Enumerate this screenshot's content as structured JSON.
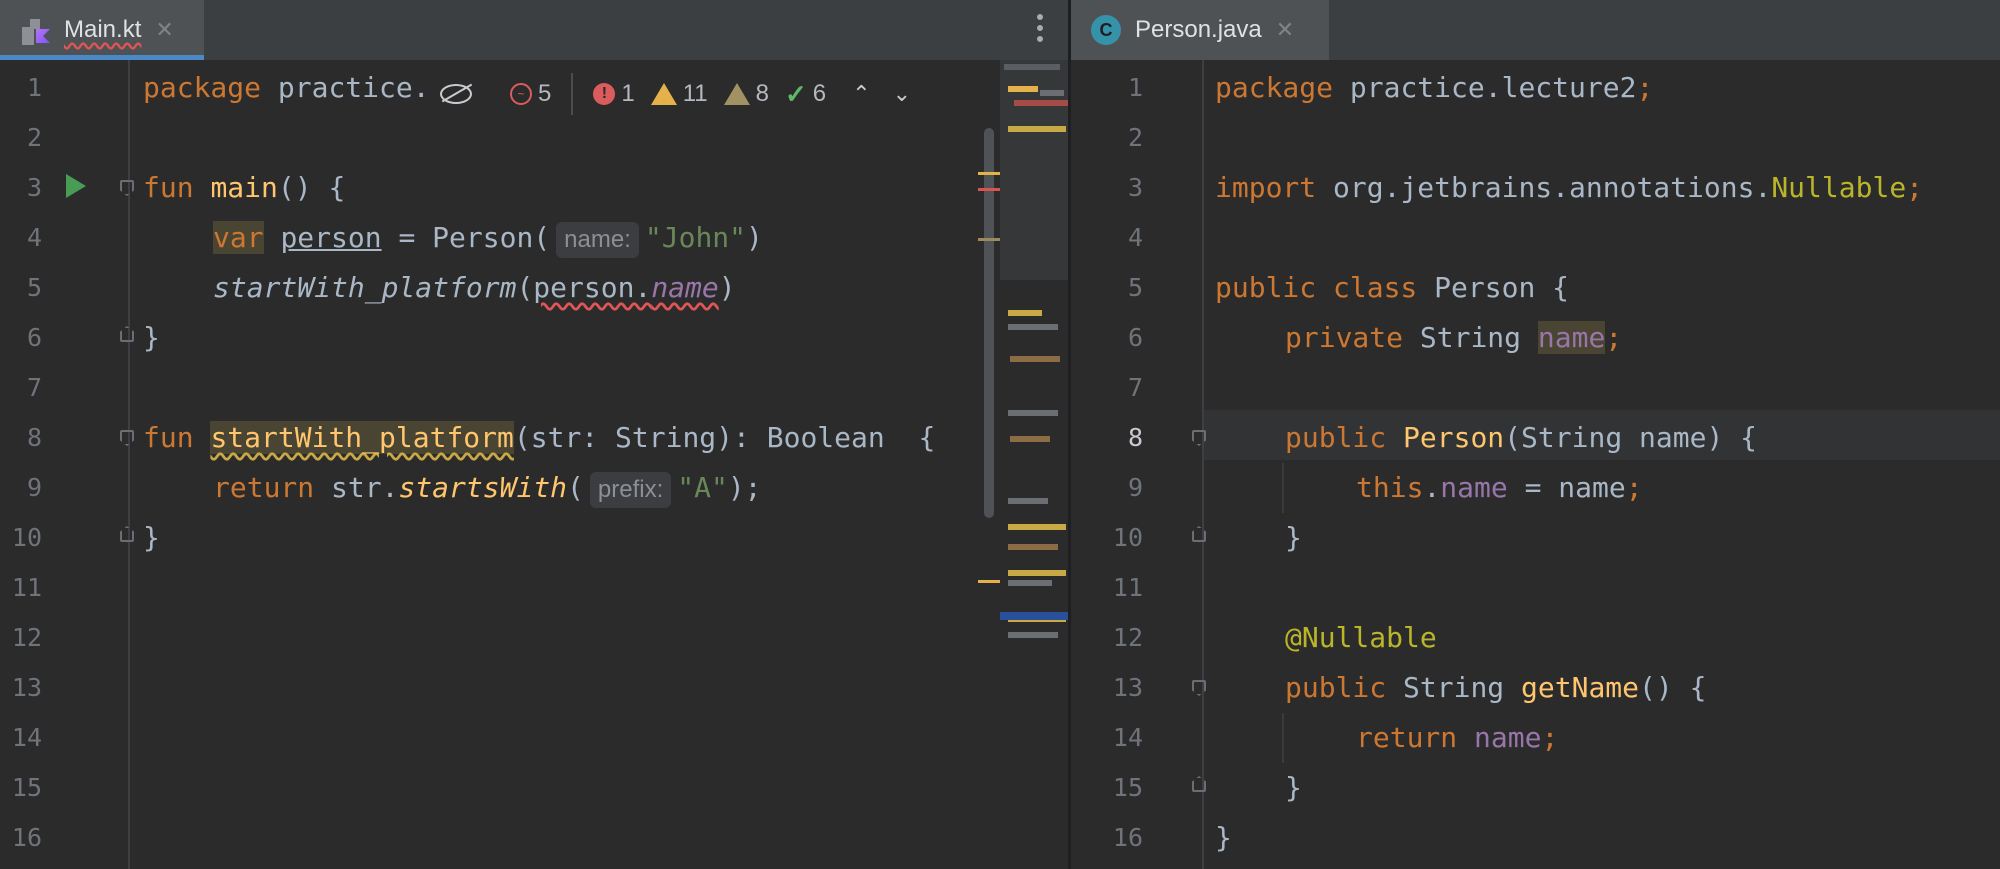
{
  "left_editor": {
    "tab": {
      "label": "Main.kt",
      "close": "✕"
    },
    "line_numbers": [
      "1",
      "2",
      "3",
      "4",
      "5",
      "6",
      "7",
      "8",
      "9",
      "10",
      "11",
      "12",
      "13",
      "14",
      "15",
      "16"
    ],
    "inspection": {
      "typos": "5",
      "errors": "1",
      "warnings": "11",
      "weak_warnings": "8",
      "ok": "6"
    },
    "code": {
      "l1_kw": "package",
      "l1_rest": " practice.",
      "l3_kw": "fun",
      "l3_fn": "main",
      "l3_rest": "() {",
      "l4_kw": "var",
      "l4_var": "person",
      "l4_mid": " = Person(",
      "l4_hint": "name:",
      "l4_str": "\"John\"",
      "l4_end": ")",
      "l5_fn": "startWith_platform",
      "l5_open": "(",
      "l5_obj": "person.",
      "l5_prop": "name",
      "l5_close": ")",
      "l6": "}",
      "l8_kw": "fun",
      "l8_fn": "startWith_platform",
      "l8_rest": "(str: String): Boolean  {",
      "l9_kw": "return",
      "l9_mid": " str.",
      "l9_fn": "startsWith",
      "l9_open": "(",
      "l9_hint": "prefix:",
      "l9_str": "\"A\"",
      "l9_end": ");",
      "l10": "}"
    }
  },
  "right_editor": {
    "tab": {
      "label": "Person.java",
      "icon_letter": "C",
      "close": "✕"
    },
    "line_numbers": [
      "1",
      "2",
      "3",
      "4",
      "5",
      "6",
      "7",
      "8",
      "9",
      "10",
      "11",
      "12",
      "13",
      "14",
      "15",
      "16"
    ],
    "current_line": "8",
    "code": {
      "l1_kw": "package",
      "l1_rest": " practice.lecture2",
      "l1_semi": ";",
      "l3_kw": "import",
      "l3_rest": " org.jetbrains.annotations.",
      "l3_cls": "Nullable",
      "l3_semi": ";",
      "l5_kw": "public class",
      "l5_rest": " Person {",
      "l6_kw": "private",
      "l6_mid": " String ",
      "l6_fld": "name",
      "l6_semi": ";",
      "l8_kw": "public",
      "l8_fn": " Person",
      "l8_rest": "(String name) {",
      "l9_kw": "this",
      "l9_dot": ".",
      "l9_fld": "name",
      "l9_rest": " = name",
      "l9_semi": ";",
      "l10": "}",
      "l12_ann": "@Nullable",
      "l13_kw": "public",
      "l13_mid": " String ",
      "l13_fn": "getName",
      "l13_rest": "() {",
      "l14_kw": "return",
      "l14_fld": " name",
      "l14_semi": ";",
      "l15": "}",
      "l16": "}"
    }
  },
  "colors": {
    "background": "#2b2b2b",
    "keyword": "#cc7832",
    "function": "#ffc66d",
    "string": "#6a8759",
    "field": "#9876aa",
    "annotation": "#bbb529",
    "text": "#a9b7c6"
  }
}
